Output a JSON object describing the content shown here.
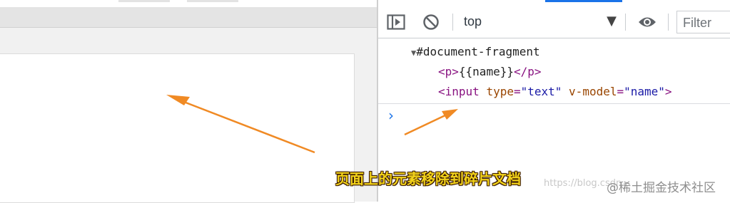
{
  "devtools": {
    "toolbar": {
      "sidebar_toggle_icon": "sidebar-toggle-icon",
      "clear_icon": "block-icon",
      "context_label": "top",
      "context_caret": "▼",
      "eye_icon": "eye-icon",
      "filter_placeholder": "Filter"
    },
    "elements": {
      "fragment": "#document-fragment",
      "p_open": "<p>",
      "p_text": "{{name}}",
      "p_close": "</p>",
      "input_open": "<input",
      "attr_type_name": "type",
      "attr_type_value": "\"text\"",
      "attr_model_name": "v-model",
      "attr_model_value": "\"name\"",
      "input_close": ">"
    },
    "console_prompt": "›",
    "accent_color": "#1a73e8"
  },
  "annotation": {
    "caption": "页面上的元素移除到碎片文档",
    "arrow_color": "#f08a24",
    "caption_color": "#f2d21a"
  },
  "watermark": {
    "url": "https://blog.csdn",
    "brand": "@稀土掘金技术社区"
  }
}
